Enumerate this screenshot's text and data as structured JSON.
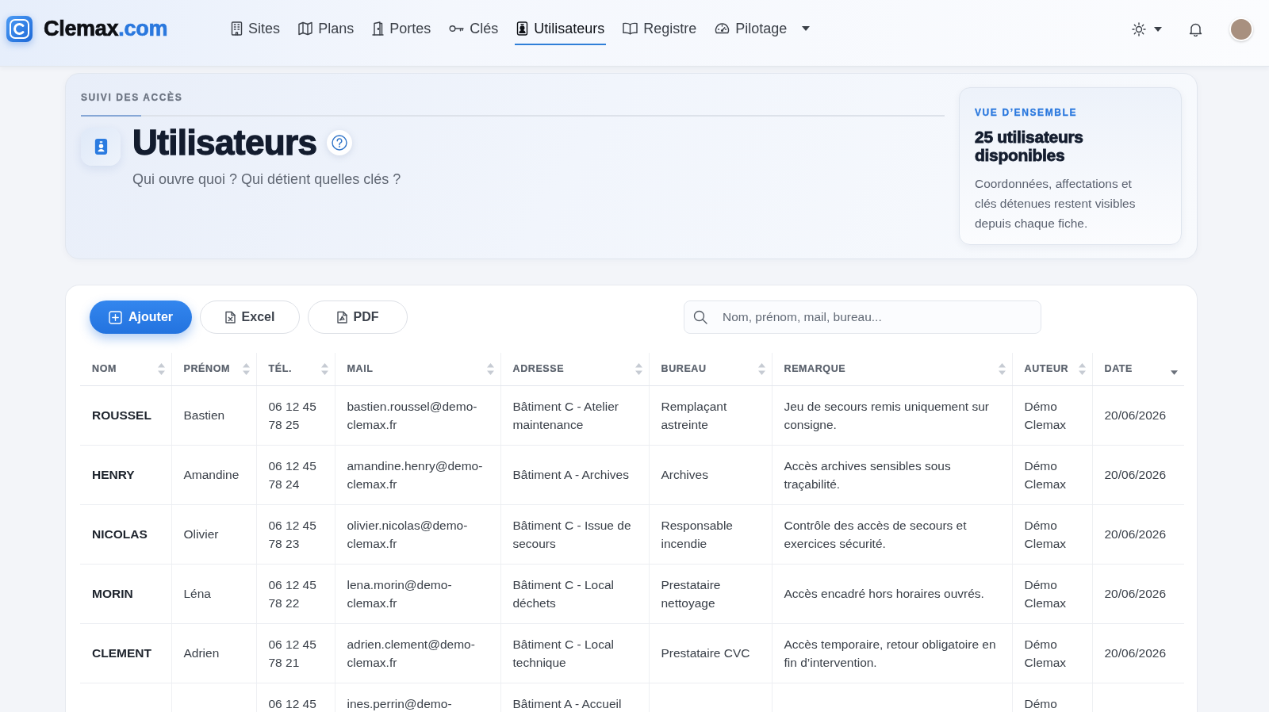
{
  "navbar": {
    "brand": {
      "name": "Clemax",
      "domain": ".com"
    },
    "items": [
      {
        "label": "Sites",
        "selected": false,
        "dropdown": false
      },
      {
        "label": "Plans",
        "selected": false,
        "dropdown": false
      },
      {
        "label": "Portes",
        "selected": false,
        "dropdown": false
      },
      {
        "label": "Clés",
        "selected": false,
        "dropdown": false
      },
      {
        "label": "Utilisateurs",
        "selected": true,
        "dropdown": false
      },
      {
        "label": "Registre",
        "selected": false,
        "dropdown": false
      },
      {
        "label": "Pilotage",
        "selected": false,
        "dropdown": true
      }
    ]
  },
  "header": {
    "eyebrow": "SUIVI DES ACCÈS",
    "title": "Utilisateurs",
    "subtitle": "Qui ouvre quoi ? Qui détient quelles clés ?",
    "overview": {
      "eyebrow": "VUE D’ENSEMBLE",
      "title": "25 utilisateurs disponibles",
      "text": "Coordonnées, affectations et clés détenues restent visibles depuis chaque fiche."
    }
  },
  "toolbar": {
    "buttons": [
      {
        "label": "Ajouter",
        "kind": "primary"
      },
      {
        "label": "Excel",
        "kind": "outline"
      },
      {
        "label": "PDF",
        "kind": "outline"
      }
    ],
    "search": {
      "placeholder": "Nom, prénom, mail, bureau..."
    }
  },
  "table": {
    "columns": [
      {
        "label": "NOM",
        "sorted": false
      },
      {
        "label": "PRÉNOM",
        "sorted": false
      },
      {
        "label": "TÉL.",
        "sorted": false
      },
      {
        "label": "MAIL",
        "sorted": false
      },
      {
        "label": "ADRESSE",
        "sorted": false
      },
      {
        "label": "BUREAU",
        "sorted": false
      },
      {
        "label": "REMARQUE",
        "sorted": false
      },
      {
        "label": "AUTEUR",
        "sorted": false
      },
      {
        "label": "DATE",
        "sorted": true
      }
    ],
    "rows": [
      {
        "nom": "ROUSSEL",
        "prenom": "Bastien",
        "tel": "06 12 45 78 25",
        "mail": "bastien.roussel@demo-clemax.fr",
        "adresse": "Bâtiment C - Atelier maintenance",
        "bureau": "Remplaçant astreinte",
        "remarque": "Jeu de secours remis uniquement sur consigne.",
        "auteur": "Démo Clemax",
        "date": "20/06/2026"
      },
      {
        "nom": "HENRY",
        "prenom": "Amandine",
        "tel": "06 12 45 78 24",
        "mail": "amandine.henry@demo-clemax.fr",
        "adresse": "Bâtiment A - Archives",
        "bureau": "Archives",
        "remarque": "Accès archives sensibles sous traçabilité.",
        "auteur": "Démo Clemax",
        "date": "20/06/2026"
      },
      {
        "nom": "NICOLAS",
        "prenom": "Olivier",
        "tel": "06 12 45 78 23",
        "mail": "olivier.nicolas@demo-clemax.fr",
        "adresse": "Bâtiment C - Issue de secours",
        "bureau": "Responsable incendie",
        "remarque": "Contrôle des accès de secours et exercices sécurité.",
        "auteur": "Démo Clemax",
        "date": "20/06/2026"
      },
      {
        "nom": "MORIN",
        "prenom": "Léna",
        "tel": "06 12 45 78 22",
        "mail": "lena.morin@demo-clemax.fr",
        "adresse": "Bâtiment C - Local déchets",
        "bureau": "Prestataire nettoyage",
        "remarque": "Accès encadré hors horaires ouvrés.",
        "auteur": "Démo Clemax",
        "date": "20/06/2026"
      },
      {
        "nom": "CLEMENT",
        "prenom": "Adrien",
        "tel": "06 12 45 78 21",
        "mail": "adrien.clement@demo-clemax.fr",
        "adresse": "Bâtiment C - Local technique",
        "bureau": "Prestataire CVC",
        "remarque": "Accès temporaire, retour obligatoire en fin d’intervention.",
        "auteur": "Démo Clemax",
        "date": "20/06/2026"
      },
      {
        "tel": "06 12 45",
        "mail": "ines.perrin@demo-",
        "adresse": "Bâtiment A - Accueil",
        "auteur": "Démo"
      }
    ]
  }
}
